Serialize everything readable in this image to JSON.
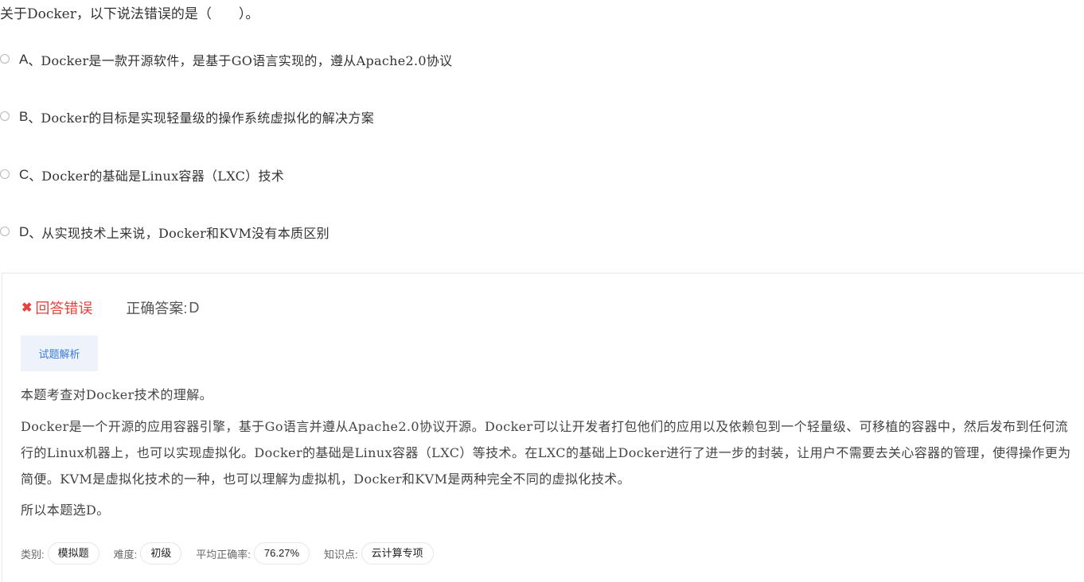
{
  "question": {
    "text": "关于Docker，以下说法错误的是（　　）。"
  },
  "options": [
    {
      "letter": "A",
      "sep": "、",
      "text": "Docker是一款开源软件，是基于GO语言实现的，遵从Apache2.0协议"
    },
    {
      "letter": "B",
      "sep": "、",
      "text": "Docker的目标是实现轻量级的操作系统虚拟化的解决方案"
    },
    {
      "letter": "C",
      "sep": "、",
      "text": "Docker的基础是Linux容器（LXC）技术"
    },
    {
      "letter": "D",
      "sep": "、",
      "text": "从实现技术上来说，Docker和KVM没有本质区别"
    }
  ],
  "result": {
    "icon": "close-icon",
    "status": "回答错误",
    "correct_label": "正确答案:",
    "correct_value": "D",
    "status_color": "#e64340"
  },
  "analysis": {
    "tab_label": "试题解析",
    "tab_color": "#3b7bd4",
    "paragraphs": [
      "本题考查对Docker技术的理解。",
      "Docker是一个开源的应用容器引擎，基于Go语言并遵从Apache2.0协议开源。Docker可以让开发者打包他们的应用以及依赖包到一个轻量级、可移植的容器中，然后发布到任何流行的Linux机器上，也可以实现虚拟化。Docker的基础是Linux容器（LXC）等技术。在LXC的基础上Docker进行了进一步的封装，让用户不需要去关心容器的管理，使得操作更为简便。KVM是虚拟化技术的一种，也可以理解为虚拟机，Docker和KVM是两种完全不同的虚拟化技术。",
      "所以本题选D。"
    ]
  },
  "meta": {
    "category_label": "类别:",
    "category_value": "模拟题",
    "difficulty_label": "难度:",
    "difficulty_value": "初级",
    "accuracy_label": "平均正确率:",
    "accuracy_value": "76.27%",
    "knowledge_label": "知识点:",
    "knowledge_value": "云计算专项"
  }
}
